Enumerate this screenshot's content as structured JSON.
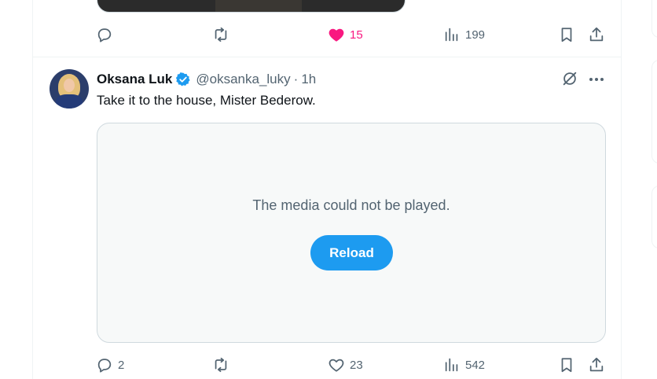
{
  "prev_tweet": {
    "actions": {
      "replies": "",
      "reposts": "",
      "likes": "15",
      "views": "199"
    }
  },
  "tweet": {
    "author_name": "Oksana Luk",
    "handle": "@oksanka_luky",
    "separator": "·",
    "time": "1h",
    "text": "Take it to the house, Mister Bederow.",
    "media": {
      "message": "The media could not be played.",
      "reload_label": "Reload"
    },
    "actions": {
      "replies": "2",
      "reposts": "",
      "likes": "23",
      "views": "542"
    }
  },
  "colors": {
    "accent": "#1d9bf0",
    "like": "#f91880",
    "muted": "#536471"
  }
}
